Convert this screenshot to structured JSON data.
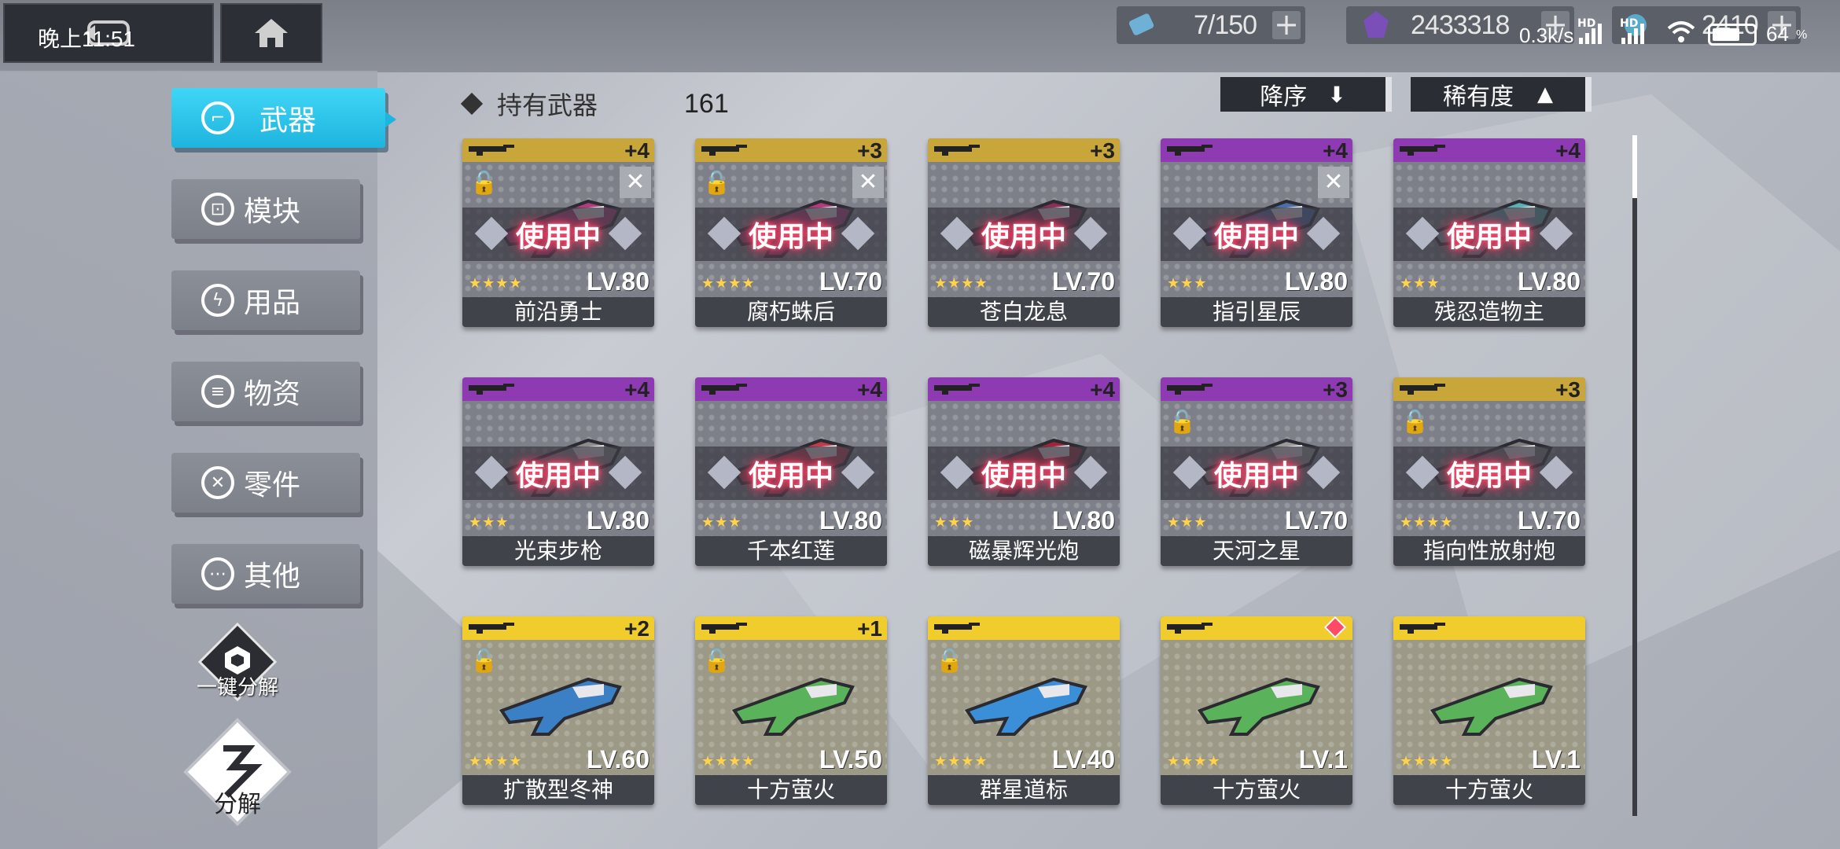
{
  "status_bar": {
    "time": "晚上11:51",
    "net_speed": "0.3k/s",
    "hd1": "HD",
    "hd2": "HD",
    "battery": "64"
  },
  "top_nav": {
    "back_icon": "back-icon",
    "home_icon": "home-icon"
  },
  "resources": [
    {
      "icon": "ticket-icon",
      "amount": "7/150"
    },
    {
      "icon": "crystal-icon",
      "amount": "2433318"
    },
    {
      "icon": "gem-icon",
      "amount": "2410"
    }
  ],
  "sidebar": {
    "items": [
      {
        "label": "武器",
        "icon": "gun-icon",
        "active": true
      },
      {
        "label": "模块",
        "icon": "module-icon",
        "active": false
      },
      {
        "label": "用品",
        "icon": "bolt-icon",
        "active": false
      },
      {
        "label": "物资",
        "icon": "supply-icon",
        "active": false
      },
      {
        "label": "零件",
        "icon": "parts-icon",
        "active": false
      },
      {
        "label": "其他",
        "icon": "more-icon",
        "active": false
      }
    ],
    "bulk_dismantle": "一键分解",
    "dismantle": "分解"
  },
  "header": {
    "title": "持有武器",
    "count": "161",
    "sort_desc": "降序",
    "sort_rarity": "稀有度"
  },
  "inuse_label": "使用中",
  "cards": [
    {
      "name": "前沿勇士",
      "level": "LV.80",
      "refine": "+4",
      "stars": "★★★★",
      "rarity": "gold",
      "locked": true,
      "wrench": true,
      "in_use": true
    },
    {
      "name": "腐朽蛛后",
      "level": "LV.70",
      "refine": "+3",
      "stars": "★★★★",
      "rarity": "gold",
      "locked": true,
      "wrench": true,
      "in_use": true
    },
    {
      "name": "苍白龙息",
      "level": "LV.70",
      "refine": "+3",
      "stars": "★★★★",
      "rarity": "gold",
      "locked": false,
      "wrench": false,
      "in_use": true
    },
    {
      "name": "指引星辰",
      "level": "LV.80",
      "refine": "+4",
      "stars": "★★★",
      "rarity": "purple",
      "locked": false,
      "wrench": true,
      "in_use": true
    },
    {
      "name": "残忍造物主",
      "level": "LV.80",
      "refine": "+4",
      "stars": "★★★",
      "rarity": "purple",
      "locked": false,
      "wrench": false,
      "in_use": true
    },
    {
      "name": "光束步枪",
      "level": "LV.80",
      "refine": "+4",
      "stars": "★★★",
      "rarity": "purple",
      "locked": false,
      "wrench": false,
      "in_use": true
    },
    {
      "name": "千本红莲",
      "level": "LV.80",
      "refine": "+4",
      "stars": "★★★",
      "rarity": "purple",
      "locked": false,
      "wrench": false,
      "in_use": true
    },
    {
      "name": "磁暴辉光炮",
      "level": "LV.80",
      "refine": "+4",
      "stars": "★★★",
      "rarity": "purple",
      "locked": false,
      "wrench": false,
      "in_use": true
    },
    {
      "name": "天河之星",
      "level": "LV.70",
      "refine": "+3",
      "stars": "★★★",
      "rarity": "purple",
      "locked": true,
      "wrench": false,
      "in_use": true
    },
    {
      "name": "指向性放射炮",
      "level": "LV.70",
      "refine": "+3",
      "stars": "★★★★",
      "rarity": "gold",
      "locked": true,
      "wrench": false,
      "in_use": true
    },
    {
      "name": "扩散型冬神",
      "level": "LV.60",
      "refine": "+2",
      "stars": "★★★★",
      "rarity": "yellow",
      "locked": true,
      "wrench": false,
      "in_use": false
    },
    {
      "name": "十方萤火",
      "level": "LV.50",
      "refine": "+1",
      "stars": "★★★★",
      "rarity": "yellow",
      "locked": true,
      "wrench": false,
      "in_use": false
    },
    {
      "name": "群星道标",
      "level": "LV.40",
      "refine": "",
      "stars": "★★★★",
      "rarity": "yellow",
      "locked": true,
      "wrench": false,
      "in_use": false
    },
    {
      "name": "十方萤火",
      "level": "LV.1",
      "refine": "",
      "stars": "★★★★",
      "rarity": "yellow",
      "locked": false,
      "wrench": false,
      "in_use": false,
      "new": true
    },
    {
      "name": "十方萤火",
      "level": "LV.1",
      "refine": "",
      "stars": "★★★★",
      "rarity": "yellow",
      "locked": false,
      "wrench": false,
      "in_use": false
    }
  ]
}
